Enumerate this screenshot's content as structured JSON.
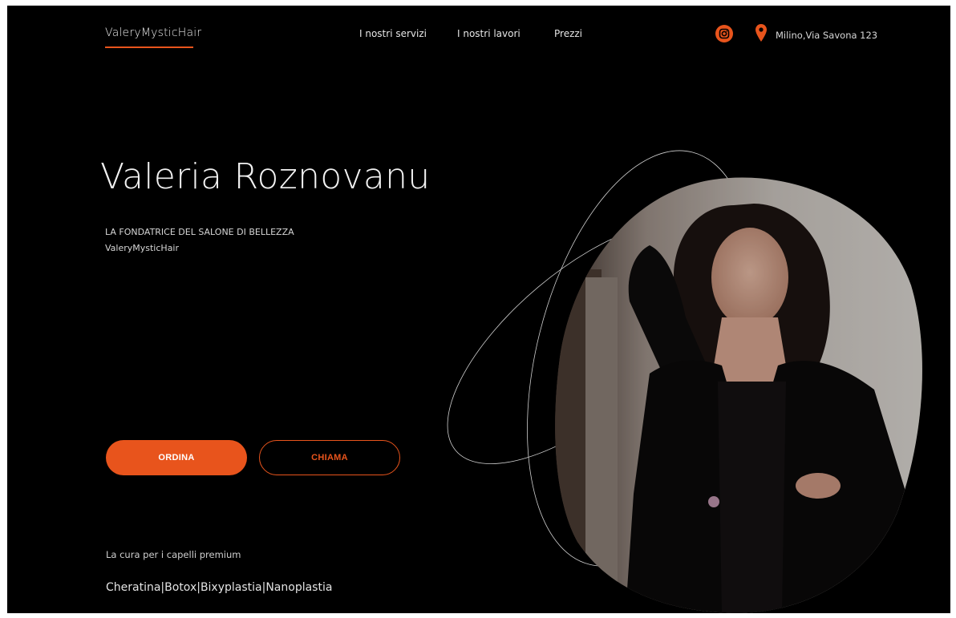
{
  "header": {
    "logo": "ValeryMysticHair",
    "nav": [
      "I nostri servizi",
      "I nostri lavori",
      "Prezzi"
    ],
    "address": "Milino,Via Savona 123",
    "icons": [
      "instagram-icon",
      "location-pin-icon"
    ]
  },
  "hero": {
    "title": "Valeria Roznovanu",
    "subtitle_line1": "LA FONDATRICE DEL SALONE DI BELLEZZA",
    "subtitle_line2": "ValeryMysticHair",
    "order_label": "ORDINA",
    "call_label": "CHIAMA",
    "tagline": "La cura per i capelli premium",
    "services": "Cheratina|Botox|Bixyplastia|Nanoplastia"
  },
  "colors": {
    "background": "#000000",
    "accent": "#e8541c",
    "text": "#f2f2f2"
  }
}
